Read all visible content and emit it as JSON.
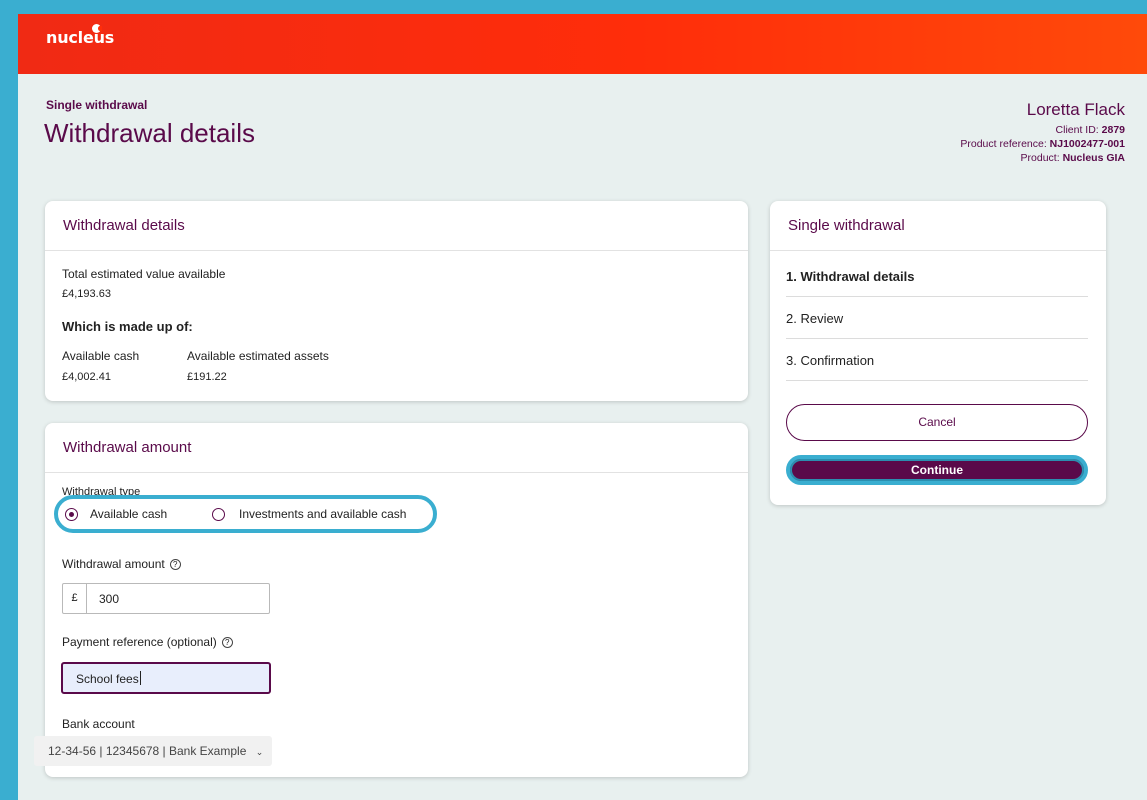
{
  "brand": {
    "logo_text": "nucleus"
  },
  "page": {
    "subtitle": "Single withdrawal",
    "title": "Withdrawal details"
  },
  "client": {
    "name": "Loretta Flack",
    "client_id_label": "Client ID: ",
    "client_id": "2879",
    "product_ref_label": "Product reference: ",
    "product_ref": "NJ1002477-001",
    "product_label": "Product: ",
    "product": "Nucleus GIA"
  },
  "details_card": {
    "heading": "Withdrawal details",
    "total_label": "Total estimated value available",
    "total_value": "£4,193.63",
    "made_up_label": "Which is made up of:",
    "cash_label": "Available cash",
    "cash_value": "£4,002.41",
    "assets_label": "Available estimated assets",
    "assets_value": "£191.22"
  },
  "amount_card": {
    "heading": "Withdrawal amount",
    "type_label": "Withdrawal type",
    "options": [
      "Available cash",
      "Investments and available cash"
    ],
    "selected_option": "Available cash",
    "amount_label": "Withdrawal amount",
    "currency": "£",
    "amount_value": "300",
    "reference_label": "Payment reference (optional)",
    "reference_value": "School fees",
    "bank_label": "Bank account",
    "bank_value": "12-34-56 | 12345678 | Bank Example"
  },
  "steps_card": {
    "heading": "Single withdrawal",
    "steps": [
      "1. Withdrawal details",
      "2. Review",
      "3. Confirmation"
    ],
    "active_step": "1. Withdrawal details",
    "cancel_label": "Cancel",
    "continue_label": "Continue"
  },
  "colors": {
    "brand_red": "#ff2d0a",
    "accent_purple": "#5a0a4a",
    "highlight_blue": "#3aaed0",
    "page_bg": "#e8f0ef"
  }
}
